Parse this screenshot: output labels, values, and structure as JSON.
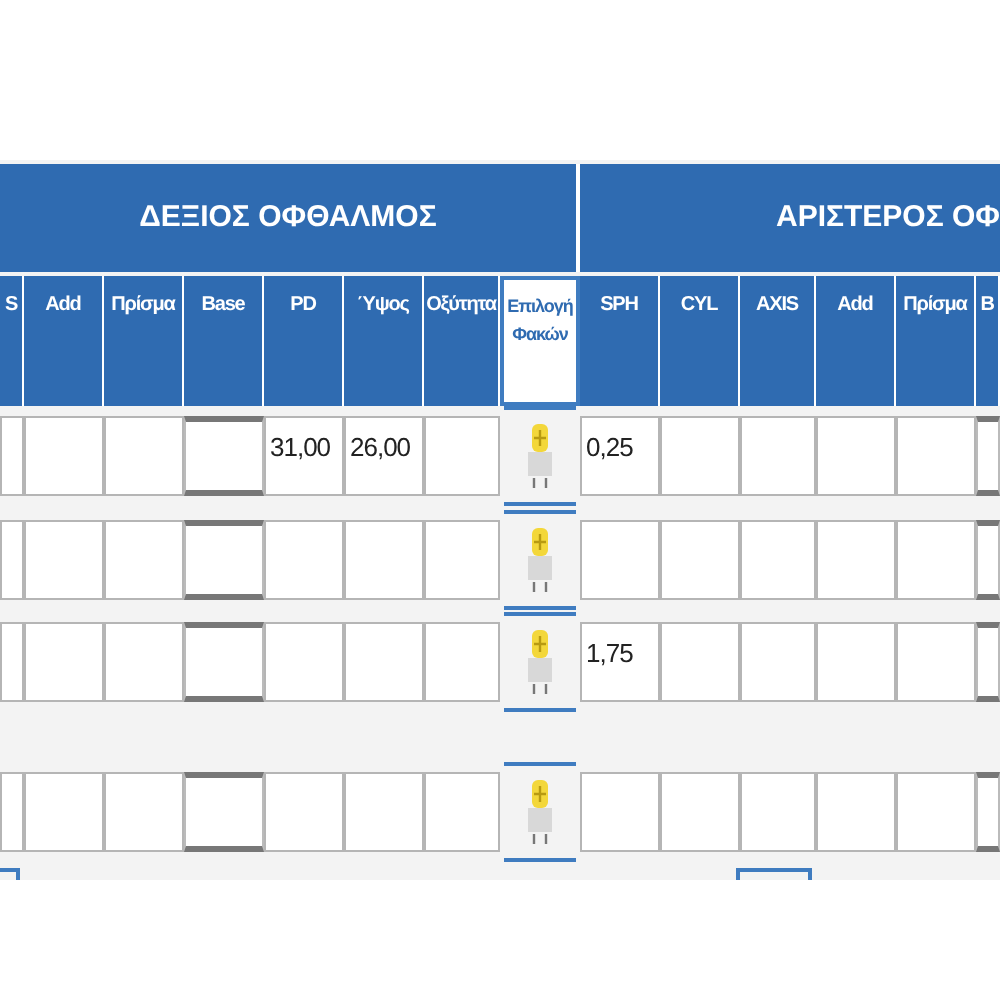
{
  "eye_headers": [
    {
      "title": "ΔΕΞΙΟΣ ΟΦΘΑΛΜΟΣ"
    },
    {
      "title": "ΑΡΙΣΤΕΡΟΣ ΟΦ"
    }
  ],
  "columns": [
    {
      "label": "S",
      "kind": "input"
    },
    {
      "label": "Add",
      "kind": "input"
    },
    {
      "label": "Πρίσμα",
      "kind": "input"
    },
    {
      "label": "Base",
      "kind": "select"
    },
    {
      "label": "PD",
      "kind": "input"
    },
    {
      "label": "Ύψος",
      "kind": "input"
    },
    {
      "label": "Οξύτητα",
      "kind": "input"
    },
    {
      "label": "Επιλογή Φακών",
      "kind": "lens"
    },
    {
      "label": "SPH",
      "kind": "input"
    },
    {
      "label": "CYL",
      "kind": "input"
    },
    {
      "label": "AXIS",
      "kind": "input"
    },
    {
      "label": "Add",
      "kind": "input"
    },
    {
      "label": "Πρίσμα",
      "kind": "input"
    },
    {
      "label": "B",
      "kind": "select"
    }
  ],
  "rows": [
    {
      "cells": [
        null,
        null,
        null,
        null,
        "31,00",
        "26,00",
        null,
        null,
        "0,25",
        null,
        null,
        null,
        null,
        null
      ]
    },
    {
      "cells": [
        null,
        null,
        null,
        null,
        null,
        null,
        null,
        null,
        null,
        null,
        null,
        null,
        null,
        null
      ]
    },
    {
      "cells": [
        null,
        null,
        null,
        null,
        null,
        null,
        null,
        null,
        "1,75",
        null,
        null,
        null,
        null,
        null
      ]
    },
    {
      "cells": [
        null,
        null,
        null,
        null,
        null,
        null,
        null,
        null,
        null,
        null,
        null,
        null,
        null,
        null
      ]
    }
  ]
}
